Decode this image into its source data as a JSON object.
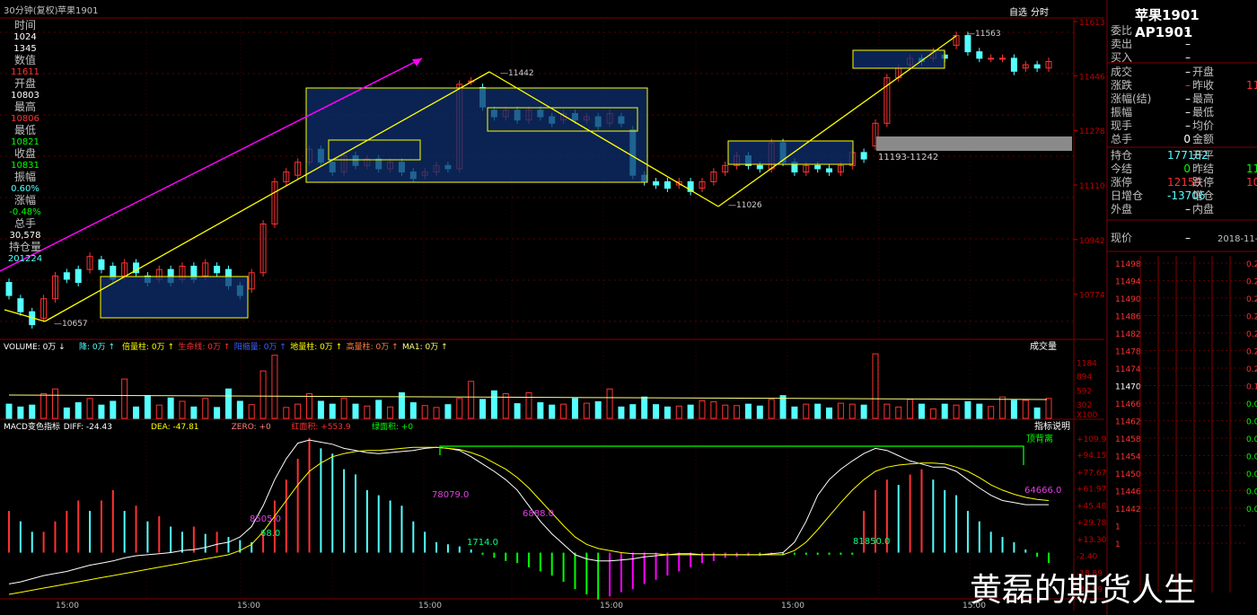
{
  "header": {
    "period_label": "30分钟(复权)",
    "symbol": "苹果1901",
    "toolbar_right": [
      "自选",
      "分时"
    ]
  },
  "left_panel": [
    {
      "k": "时间",
      "v": "1024"
    },
    {
      "k": "",
      "v": "1345"
    },
    {
      "k": "数值",
      "v": "11611"
    },
    {
      "k": "开盘",
      "v": "10803"
    },
    {
      "k": "最高",
      "v": "10806"
    },
    {
      "k": "最低",
      "v": "10821"
    },
    {
      "k": "收盘",
      "v": "10831"
    },
    {
      "k": "振幅",
      "v": "0.60%"
    },
    {
      "k": "涨幅",
      "v": "-0.48%"
    },
    {
      "k": "总手",
      "v": "30,578"
    },
    {
      "k": "持仓量",
      "v": "201224"
    }
  ],
  "quote": {
    "title": "苹果1901 AP1901",
    "rows1": [
      {
        "l": "委比",
        "v": "–"
      },
      {
        "l": "卖出",
        "v": "–"
      },
      {
        "l": "买入",
        "v": "–"
      }
    ],
    "rows2": [
      {
        "l": "成交",
        "v": "–",
        "l2": "开盘"
      },
      {
        "l": "涨跌",
        "v": "–",
        "l2": "昨收",
        "v2": "11"
      },
      {
        "l": "涨幅(结)",
        "v": "–",
        "l2": "最高"
      },
      {
        "l": "振幅",
        "v": "–",
        "l2": "最低"
      },
      {
        "l": "现手",
        "v": "–",
        "l2": "均价"
      },
      {
        "l": "总手",
        "v": "0",
        "l2": "金额"
      }
    ],
    "rows3": [
      {
        "l": "持仓",
        "v": "177182",
        "l2": "开平"
      },
      {
        "l": "今结",
        "v": "0",
        "l2": "昨结",
        "v2": "11"
      },
      {
        "l": "涨停",
        "v": "12159",
        "l2": "跌停",
        "v2": "10"
      },
      {
        "l": "日增仓",
        "v": "-13706",
        "l2": "增仓"
      },
      {
        "l": "外盘",
        "v": "–",
        "l2": "内盘"
      }
    ],
    "tick_header": {
      "l": "现价",
      "v": "–",
      "date": "2018-11-0"
    },
    "tick_prices": [
      "11498",
      "11494",
      "11490",
      "11486",
      "11482",
      "11478",
      "11474",
      "11470",
      "11466",
      "11462",
      "11458",
      "11454",
      "11450",
      "11446",
      "11442",
      "1",
      "1"
    ],
    "tick_right": [
      "0.2",
      "0.2",
      "0.2",
      "0.2",
      "0.2",
      "0.2",
      "0.2",
      "0.1",
      "0.0",
      "0.0",
      "0.0",
      "0.0",
      "0.0",
      "0.0",
      "0.0",
      "",
      ""
    ]
  },
  "volume_header": {
    "items": [
      "VOLUME: 0万",
      "降: 0万",
      "倍量柱: 0万",
      "生命线: 0万",
      "阳缩量: 0万",
      "地量柱: 0万",
      "高量柱: 0万",
      "MA1: 0万"
    ],
    "dropdown": "成交量"
  },
  "macd_header": {
    "items": [
      "MACD变色指标",
      "DIFF: -24.43",
      "DEA: -47.81",
      "ZERO: +0",
      "红面积: +553.9",
      "绿面积: +0"
    ],
    "help": "指标说明"
  },
  "watermark": "黄磊的期货人生",
  "chart_data": [
    {
      "type": "candlestick",
      "title": "苹果1901",
      "ylim": [
        10657,
        11613
      ],
      "y_ticks": [
        11613,
        11446,
        11278,
        11110,
        10942,
        10774
      ],
      "x_tick_labels": [
        "15:00",
        "15:00",
        "15:00",
        "15:00",
        "15:00",
        "15:00"
      ],
      "annotations": [
        "10657",
        "11442",
        "11026",
        "11563",
        "11193-11242"
      ],
      "candles": [
        {
          "o": 10810,
          "c": 10770
        },
        {
          "o": 10760,
          "c": 10720
        },
        {
          "o": 10720,
          "c": 10680
        },
        {
          "o": 10700,
          "c": 10760
        },
        {
          "o": 10760,
          "c": 10830
        },
        {
          "o": 10840,
          "c": 10820
        },
        {
          "o": 10850,
          "c": 10810
        },
        {
          "o": 10850,
          "c": 10890
        },
        {
          "o": 10880,
          "c": 10850
        },
        {
          "o": 10860,
          "c": 10820
        },
        {
          "o": 10830,
          "c": 10870
        },
        {
          "o": 10870,
          "c": 10840
        },
        {
          "o": 10830,
          "c": 10810
        },
        {
          "o": 10820,
          "c": 10850
        },
        {
          "o": 10850,
          "c": 10810
        },
        {
          "o": 10820,
          "c": 10860
        },
        {
          "o": 10860,
          "c": 10820
        },
        {
          "o": 10830,
          "c": 10870
        },
        {
          "o": 10860,
          "c": 10840
        },
        {
          "o": 10850,
          "c": 10800
        },
        {
          "o": 10800,
          "c": 10770
        },
        {
          "o": 10790,
          "c": 10840
        },
        {
          "o": 10840,
          "c": 10990
        },
        {
          "o": 10990,
          "c": 11120
        },
        {
          "o": 11120,
          "c": 11150
        },
        {
          "o": 11140,
          "c": 11180
        },
        {
          "o": 11180,
          "c": 11220
        },
        {
          "o": 11220,
          "c": 11180
        },
        {
          "o": 11180,
          "c": 11150
        },
        {
          "o": 11150,
          "c": 11200
        },
        {
          "o": 11200,
          "c": 11170
        },
        {
          "o": 11170,
          "c": 11190
        },
        {
          "o": 11190,
          "c": 11160
        },
        {
          "o": 11160,
          "c": 11180
        },
        {
          "o": 11180,
          "c": 11150
        },
        {
          "o": 11150,
          "c": 11130
        },
        {
          "o": 11140,
          "c": 11150
        },
        {
          "o": 11150,
          "c": 11170
        },
        {
          "o": 11170,
          "c": 11160
        },
        {
          "o": 11160,
          "c": 11420
        },
        {
          "o": 11430,
          "c": 11430
        },
        {
          "o": 11410,
          "c": 11350
        },
        {
          "o": 11340,
          "c": 11320
        },
        {
          "o": 11320,
          "c": 11340
        },
        {
          "o": 11340,
          "c": 11310
        },
        {
          "o": 11310,
          "c": 11340
        },
        {
          "o": 11340,
          "c": 11320
        },
        {
          "o": 11320,
          "c": 11300
        },
        {
          "o": 11310,
          "c": 11330
        },
        {
          "o": 11330,
          "c": 11310
        },
        {
          "o": 11310,
          "c": 11320
        },
        {
          "o": 11320,
          "c": 11290
        },
        {
          "o": 11300,
          "c": 11330
        },
        {
          "o": 11320,
          "c": 11300
        },
        {
          "o": 11280,
          "c": 11140
        },
        {
          "o": 11140,
          "c": 11120
        },
        {
          "o": 11120,
          "c": 11110
        },
        {
          "o": 11120,
          "c": 11100
        },
        {
          "o": 11110,
          "c": 11120
        },
        {
          "o": 11120,
          "c": 11090
        },
        {
          "o": 11100,
          "c": 11120
        },
        {
          "o": 11120,
          "c": 11150
        },
        {
          "o": 11150,
          "c": 11170
        },
        {
          "o": 11170,
          "c": 11200
        },
        {
          "o": 11200,
          "c": 11170
        },
        {
          "o": 11170,
          "c": 11160
        },
        {
          "o": 11160,
          "c": 11240
        },
        {
          "o": 11240,
          "c": 11180
        },
        {
          "o": 11180,
          "c": 11150
        },
        {
          "o": 11150,
          "c": 11170
        },
        {
          "o": 11170,
          "c": 11160
        },
        {
          "o": 11160,
          "c": 11150
        },
        {
          "o": 11150,
          "c": 11170
        },
        {
          "o": 11170,
          "c": 11210
        },
        {
          "o": 11210,
          "c": 11190
        },
        {
          "o": 11230,
          "c": 11300
        },
        {
          "o": 11300,
          "c": 11440
        },
        {
          "o": 11440,
          "c": 11470
        },
        {
          "o": 11480,
          "c": 11500
        },
        {
          "o": 11500,
          "c": 11490
        },
        {
          "o": 11500,
          "c": 11520
        },
        {
          "o": 11510,
          "c": 11500
        },
        {
          "o": 11540,
          "c": 11570
        },
        {
          "o": 11570,
          "c": 11520
        },
        {
          "o": 11520,
          "c": 11500
        },
        {
          "o": 11500,
          "c": 11500
        },
        {
          "o": 11500,
          "c": 11500
        },
        {
          "o": 11500,
          "c": 11460
        },
        {
          "o": 11470,
          "c": 11480
        },
        {
          "o": 11480,
          "c": 11470
        },
        {
          "o": 11470,
          "c": 11490
        }
      ]
    },
    {
      "type": "bar",
      "title": "VOLUME",
      "y_ticks": [
        1184,
        894,
        592,
        302
      ],
      "ylim": [
        0,
        1400
      ],
      "values": [
        300,
        240,
        280,
        520,
        620,
        220,
        330,
        420,
        280,
        360,
        830,
        240,
        480,
        280,
        430,
        360,
        240,
        420,
        230,
        620,
        360,
        290,
        1000,
        1330,
        230,
        300,
        520,
        360,
        300,
        420,
        300,
        260,
        380,
        240,
        540,
        330,
        270,
        230,
        290,
        420,
        780,
        400,
        580,
        520,
        310,
        540,
        330,
        280,
        300,
        420,
        320,
        350,
        620,
        240,
        290,
        450,
        290,
        240,
        260,
        280,
        370,
        350,
        280,
        270,
        300,
        260,
        400,
        480,
        240,
        300,
        300,
        220,
        320,
        300,
        280,
        1360,
        300,
        240,
        400,
        300,
        200,
        300,
        280,
        350,
        300,
        250,
        450,
        380,
        380,
        220,
        420
      ]
    },
    {
      "type": "bar",
      "title": "MACD变色指标",
      "y_ticks": [
        "+109.9",
        "+94.15",
        "+77.67",
        "+61.97",
        "+45.48",
        "+29.78",
        "+13.30",
        "-2.40",
        "-18.89",
        "-34.59"
      ],
      "ylim": [
        -40,
        115
      ],
      "annotations": [
        "8505.0",
        "78079.0",
        "6888.0",
        "1714.0",
        "81850.0",
        "64666.0",
        "68.0",
        "顶背离"
      ],
      "values": [
        40,
        30,
        20,
        20,
        30,
        40,
        50,
        40,
        50,
        60,
        40,
        45,
        30,
        35,
        25,
        20,
        25,
        18,
        20,
        15,
        12,
        10,
        20,
        50,
        70,
        90,
        110,
        100,
        95,
        80,
        75,
        60,
        55,
        50,
        45,
        30,
        20,
        10,
        8,
        6,
        3,
        -2,
        -5,
        -8,
        -10,
        -14,
        -18,
        -22,
        -28,
        -35,
        -40,
        -45,
        -42,
        -38,
        -35,
        -30,
        -26,
        -22,
        -18,
        -14,
        -10,
        -8,
        -5,
        -4,
        -3,
        -3,
        -2,
        -2,
        -2,
        -2,
        -2,
        -2,
        -2,
        -2,
        40,
        60,
        70,
        65,
        75,
        80,
        70,
        60,
        55,
        40,
        30,
        20,
        15,
        10,
        3,
        -4,
        -10
      ],
      "diff": [
        -30,
        -28,
        -25,
        -22,
        -20,
        -18,
        -15,
        -12,
        -10,
        -8,
        -5,
        -3,
        -2,
        -1,
        0,
        2,
        3,
        5,
        8,
        10,
        15,
        25,
        45,
        70,
        90,
        105,
        108,
        106,
        104,
        100,
        98,
        96,
        95,
        96,
        97,
        98,
        100,
        101,
        100,
        98,
        92,
        85,
        78,
        70,
        60,
        45,
        30,
        18,
        8,
        -2,
        -6,
        -8,
        -8,
        -7,
        -6,
        -4,
        -3,
        -2,
        -1,
        -1,
        -2,
        -2,
        -2,
        -2,
        -2,
        -2,
        -1,
        0,
        10,
        30,
        55,
        70,
        80,
        88,
        95,
        100,
        98,
        93,
        88,
        85,
        82,
        82,
        78,
        70,
        62,
        55,
        50,
        48,
        46,
        46,
        46
      ],
      "dea": [
        -40,
        -38,
        -36,
        -34,
        -32,
        -30,
        -28,
        -26,
        -24,
        -22,
        -20,
        -18,
        -16,
        -14,
        -12,
        -10,
        -8,
        -6,
        -4,
        -2,
        2,
        8,
        20,
        35,
        50,
        65,
        78,
        86,
        92,
        95,
        97,
        98,
        98,
        99,
        100,
        101,
        101,
        101,
        100,
        99,
        96,
        92,
        86,
        80,
        72,
        62,
        50,
        38,
        26,
        15,
        8,
        4,
        2,
        0,
        -1,
        -1,
        -1,
        -2,
        -2,
        -2,
        -2,
        -2,
        -2,
        -2,
        -2,
        -2,
        -2,
        -2,
        2,
        10,
        22,
        35,
        48,
        60,
        70,
        78,
        82,
        84,
        85,
        86,
        86,
        85,
        82,
        78,
        72,
        65,
        60,
        56,
        53,
        51,
        50
      ]
    }
  ]
}
